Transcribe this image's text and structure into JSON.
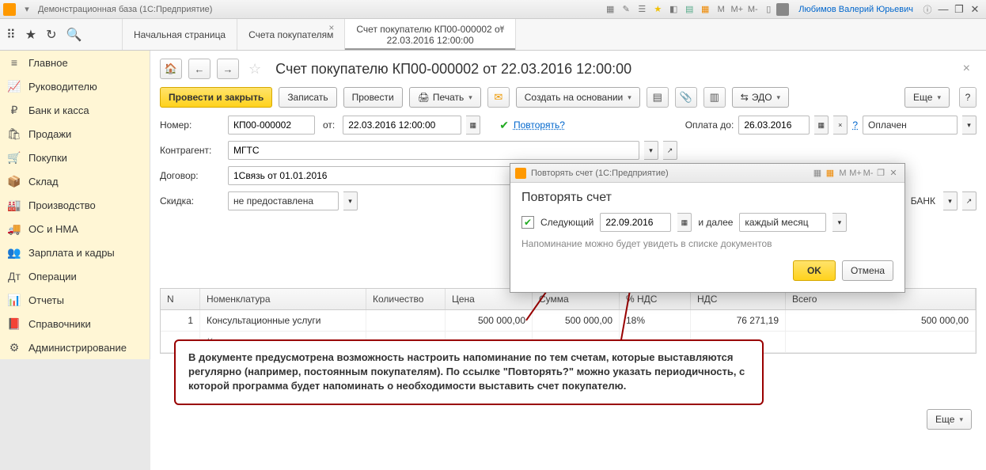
{
  "titlebar": {
    "app_title": "Демонстрационная база (1С:Предприятие)",
    "user_name": "Любимов Валерий Юрьевич",
    "mem_labels": [
      "M",
      "M+",
      "M-"
    ]
  },
  "tabs": {
    "home": "Начальная страница",
    "tab1": "Счета покупателям",
    "tab2_line1": "Счет покупателю КП00-000002 от",
    "tab2_line2": "22.03.2016 12:00:00"
  },
  "sidebar": {
    "items": [
      {
        "label": "Главное",
        "icon": "≡"
      },
      {
        "label": "Руководителю",
        "icon": "📈"
      },
      {
        "label": "Банк и касса",
        "icon": "₽"
      },
      {
        "label": "Продажи",
        "icon": "🛍"
      },
      {
        "label": "Покупки",
        "icon": "🛒"
      },
      {
        "label": "Склад",
        "icon": "📦"
      },
      {
        "label": "Производство",
        "icon": "🏭"
      },
      {
        "label": "ОС и НМА",
        "icon": "🚚"
      },
      {
        "label": "Зарплата и кадры",
        "icon": "👥"
      },
      {
        "label": "Операции",
        "icon": "Дт"
      },
      {
        "label": "Отчеты",
        "icon": "📊"
      },
      {
        "label": "Справочники",
        "icon": "📕"
      },
      {
        "label": "Администрирование",
        "icon": "⚙"
      }
    ]
  },
  "doc": {
    "title": "Счет покупателю КП00-000002 от 22.03.2016 12:00:00",
    "buttons": {
      "post_close": "Провести и закрыть",
      "save": "Записать",
      "post": "Провести",
      "print": "Печать",
      "create_based": "Создать на основании",
      "edo": "ЭДО",
      "more": "Еще"
    },
    "fields": {
      "number_lbl": "Номер:",
      "number": "КП00-000002",
      "from_lbl": "от:",
      "date": "22.03.2016 12:00:00",
      "repeat_link": "Повторять?",
      "paydue_lbl": "Оплата до:",
      "paydue": "26.03.2016",
      "status": "Оплачен",
      "counterparty_lbl": "Контрагент:",
      "counterparty": "МГТС",
      "contract_lbl": "Договор:",
      "contract": "1Связь от 01.01.2016",
      "discount_lbl": "Скидка:",
      "discount": "не предоставлена",
      "bank_suffix": "БАНК"
    }
  },
  "modal": {
    "wintitle": "Повторять счет (1С:Предприятие)",
    "heading": "Повторять счет",
    "next_lbl": "Следующий",
    "next_date": "22.09.2016",
    "then_lbl": "и далее",
    "period": "каждый месяц",
    "note": "Напоминание можно будет увидеть в списке документов",
    "ok": "OK",
    "cancel": "Отмена",
    "mem_labels": [
      "M",
      "M+",
      "M-"
    ]
  },
  "callout": {
    "text": "В документе предусмотрена возможность настроить напоминание по тем счетам, которые выставляются регулярно (например, постоянным покупателям). По ссылке \"Повторять?\" можно указать периодичность, с которой программа будет напоминать о необходимости выставить счет покупателю."
  },
  "table": {
    "more": "Еще",
    "headers": {
      "n": "N",
      "nom": "Номенклатура",
      "qty": "Количество",
      "price": "Цена",
      "sum": "Сумма",
      "vat": "% НДС",
      "nds": "НДС",
      "total": "Всего"
    },
    "rows": [
      {
        "n": "1",
        "nom": "Консультационные услуги",
        "qty": "",
        "price": "500 000,00",
        "sum": "500 000,00",
        "vat": "18%",
        "nds": "76 271,19",
        "total": "500 000,00"
      },
      {
        "nom_sub": "Консультационные услуги"
      }
    ]
  }
}
